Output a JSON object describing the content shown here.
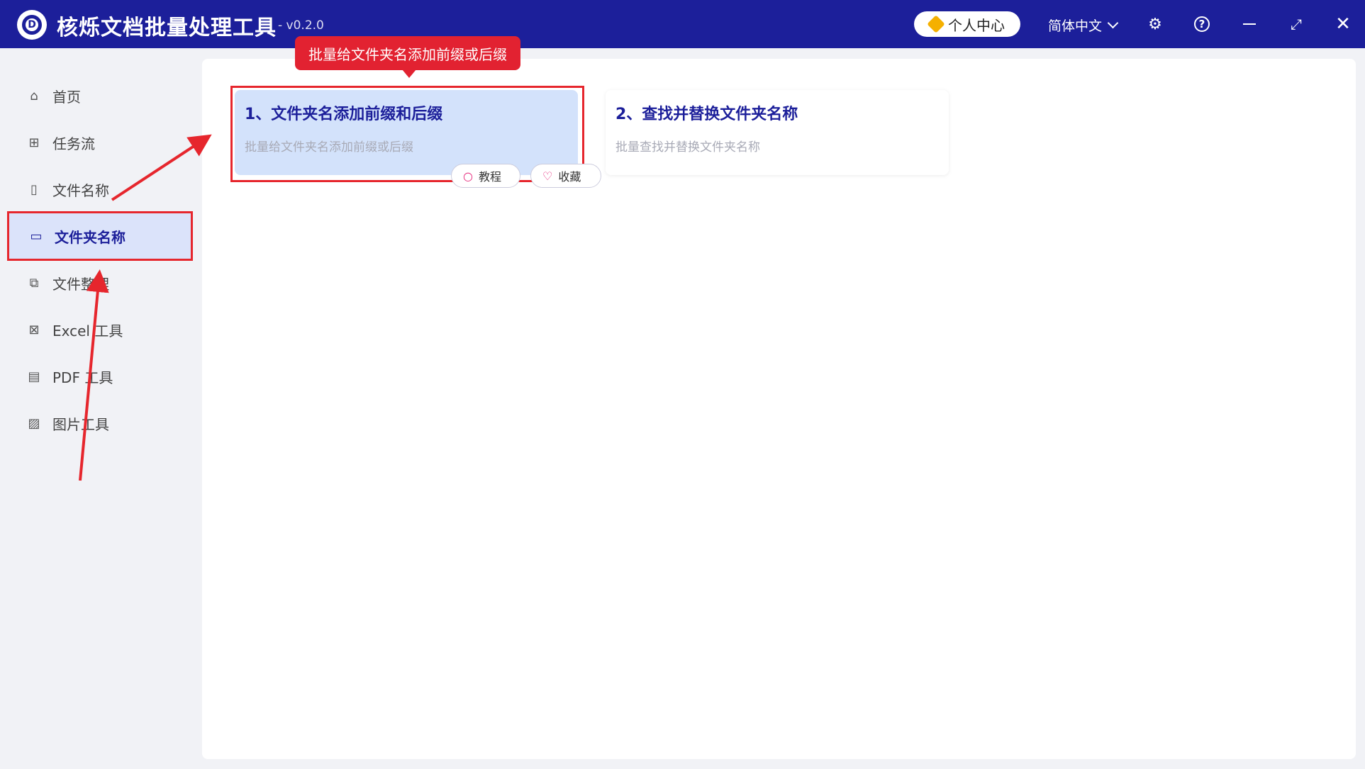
{
  "app": {
    "title": "核烁文档批量处理工具",
    "version": "- v0.2.0",
    "user_center_label": "个人中心",
    "language_label": "简体中文",
    "brand_color": "#1c1f9a",
    "highlight_color": "#e6262d"
  },
  "sidebar": {
    "items": [
      {
        "label": "首页",
        "icon": "home-icon"
      },
      {
        "label": "任务流",
        "icon": "workflow-icon"
      },
      {
        "label": "文件名称",
        "icon": "file-name-icon"
      },
      {
        "label": "文件夹名称",
        "icon": "folder-icon",
        "active": true
      },
      {
        "label": "文件整理",
        "icon": "organize-icon"
      },
      {
        "label": "Excel 工具",
        "icon": "excel-icon"
      },
      {
        "label": "PDF 工具",
        "icon": "pdf-icon"
      },
      {
        "label": "图片工具",
        "icon": "image-icon"
      }
    ]
  },
  "tooltip": {
    "text": "批量给文件夹名添加前缀或后缀"
  },
  "cards": [
    {
      "title": "1、文件夹名添加前缀和后缀",
      "desc": "批量给文件夹名添加前缀或后缀",
      "tutorial_label": "教程",
      "favorite_label": "收藏",
      "selected": true
    },
    {
      "title": "2、查找并替换文件夹名称",
      "desc": "批量查找并替换文件夹名称"
    }
  ]
}
